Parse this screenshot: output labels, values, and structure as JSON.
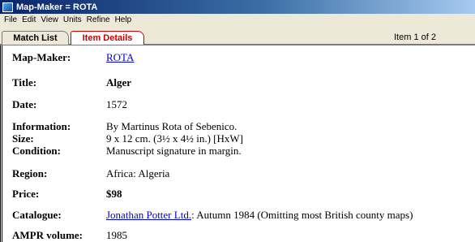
{
  "window": {
    "title": "Map-Maker = ROTA"
  },
  "menu": [
    "File",
    "Edit",
    "View",
    "Units",
    "Refine",
    "Help"
  ],
  "tabs": {
    "match_list": "Match List",
    "item_details": "Item Details"
  },
  "item_counter": "Item 1 of 2",
  "details": {
    "map_maker": {
      "label": "Map-Maker:",
      "value": "ROTA"
    },
    "title": {
      "label": "Title:",
      "value": "Alger"
    },
    "date": {
      "label": "Date:",
      "value": "1572"
    },
    "information": {
      "label": "Information:",
      "value": "By Martinus Rota of Sebenico."
    },
    "size": {
      "label": "Size:",
      "value": "9 x 12 cm. (3½ x 4½ in.) [HxW]"
    },
    "condition": {
      "label": "Condition:",
      "value": "Manuscript signature in margin."
    },
    "region": {
      "label": "Region:",
      "value": "Africa: Algeria"
    },
    "price": {
      "label": "Price:",
      "value": "$98"
    },
    "catalogue": {
      "label": "Catalogue:",
      "link": "Jonathan Potter Ltd.",
      "text": ": Autumn 1984 (Omitting most British county maps)"
    },
    "ampr_volume": {
      "label": "AMPR volume:",
      "value": "1985"
    }
  }
}
